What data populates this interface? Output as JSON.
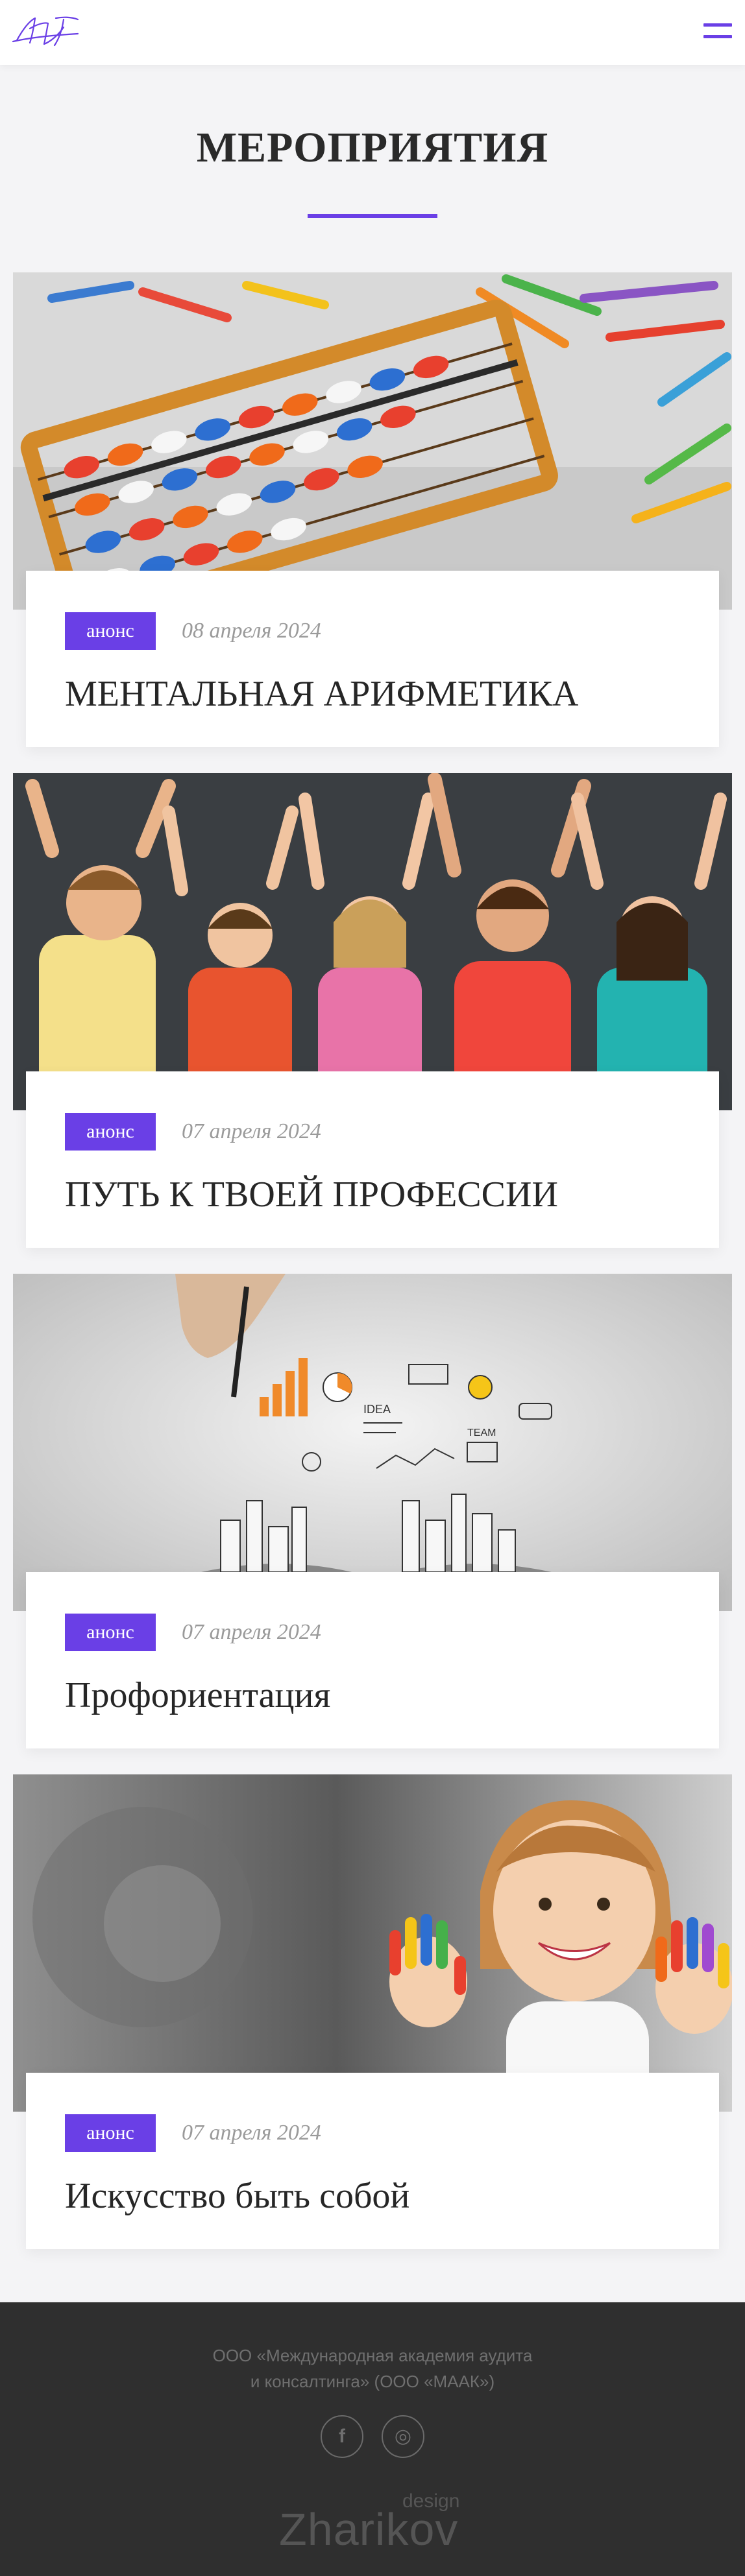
{
  "header": {
    "logo_icon": "monogram-logo-icon",
    "menu_icon": "hamburger-menu-icon"
  },
  "page": {
    "title": "МЕРОПРИЯТИЯ"
  },
  "events": [
    {
      "badge": "анонс",
      "date": "08 апреля 2024",
      "title": "МЕНТАЛЬНАЯ АРИФМЕТИКА",
      "image_subject": "abacus and colored pencils"
    },
    {
      "badge": "анонс",
      "date": "07 апреля 2024",
      "title": "ПУТЬ К ТВОЕЙ ПРОФЕССИИ",
      "image_subject": "children with raised hands"
    },
    {
      "badge": "анонс",
      "date": "07 апреля 2024",
      "title": "Профориентация",
      "image_subject": "hand drawing business sketches over a book"
    },
    {
      "badge": "анонс",
      "date": "07 апреля 2024",
      "title": "Искусство быть собой",
      "image_subject": "girl with painted hands"
    }
  ],
  "footer": {
    "company_line1": "ООО «Международная академия аудита",
    "company_line2": "и консалтинга» (ООО «МААК»)",
    "social": [
      {
        "name": "facebook",
        "glyph": "f",
        "icon": "facebook-icon"
      },
      {
        "name": "instagram",
        "glyph": "◎",
        "icon": "instagram-icon"
      }
    ],
    "designer_name": "Zharikov",
    "designer_sub": "design"
  },
  "colors": {
    "accent": "#6a3fe6",
    "footer_bg": "#2f2f2f",
    "page_bg": "#f4f4f6"
  }
}
